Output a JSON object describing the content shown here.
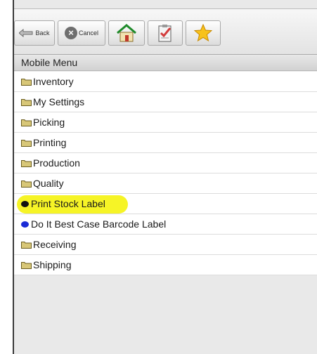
{
  "toolbar": {
    "back_label": "Back",
    "cancel_label": "Cancel"
  },
  "menu": {
    "title": "Mobile Menu",
    "items": [
      {
        "label": "Inventory",
        "type": "folder"
      },
      {
        "label": "My Settings",
        "type": "folder"
      },
      {
        "label": "Picking",
        "type": "folder"
      },
      {
        "label": "Printing",
        "type": "folder"
      },
      {
        "label": "Production",
        "type": "folder"
      },
      {
        "label": "Quality",
        "type": "folder"
      },
      {
        "label": "Print Stock Label",
        "type": "action",
        "dot_color": "#111111",
        "highlighted": true
      },
      {
        "label": "Do It Best Case Barcode Label",
        "type": "action",
        "dot_color": "#1a2bd6"
      },
      {
        "label": "Receiving",
        "type": "folder"
      },
      {
        "label": "Shipping",
        "type": "folder"
      }
    ]
  },
  "colors": {
    "highlight": "#f5f200",
    "folder": "#d8c778"
  }
}
